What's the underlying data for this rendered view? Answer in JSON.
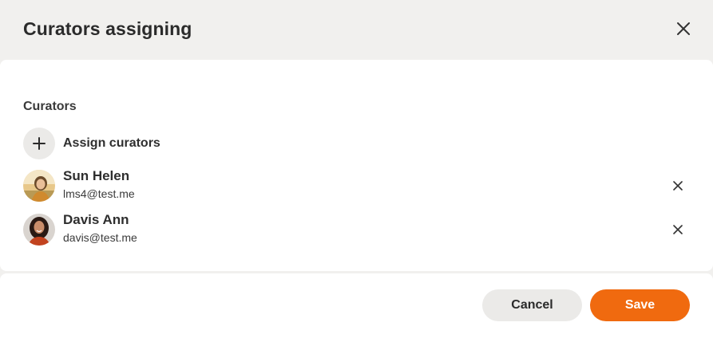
{
  "dialog": {
    "title": "Curators assigning",
    "close_icon": "close-icon"
  },
  "section": {
    "label": "Curators",
    "assign_label": "Assign curators",
    "assign_icon": "plus-icon"
  },
  "curators": [
    {
      "name": "Sun Helen",
      "email": "lms4@test.me"
    },
    {
      "name": "Davis Ann",
      "email": "davis@test.me"
    }
  ],
  "footer": {
    "cancel_label": "Cancel",
    "save_label": "Save"
  },
  "colors": {
    "accent": "#f06a0f",
    "header_bg": "#f1f0ee",
    "secondary_button_bg": "#ebeae8"
  }
}
